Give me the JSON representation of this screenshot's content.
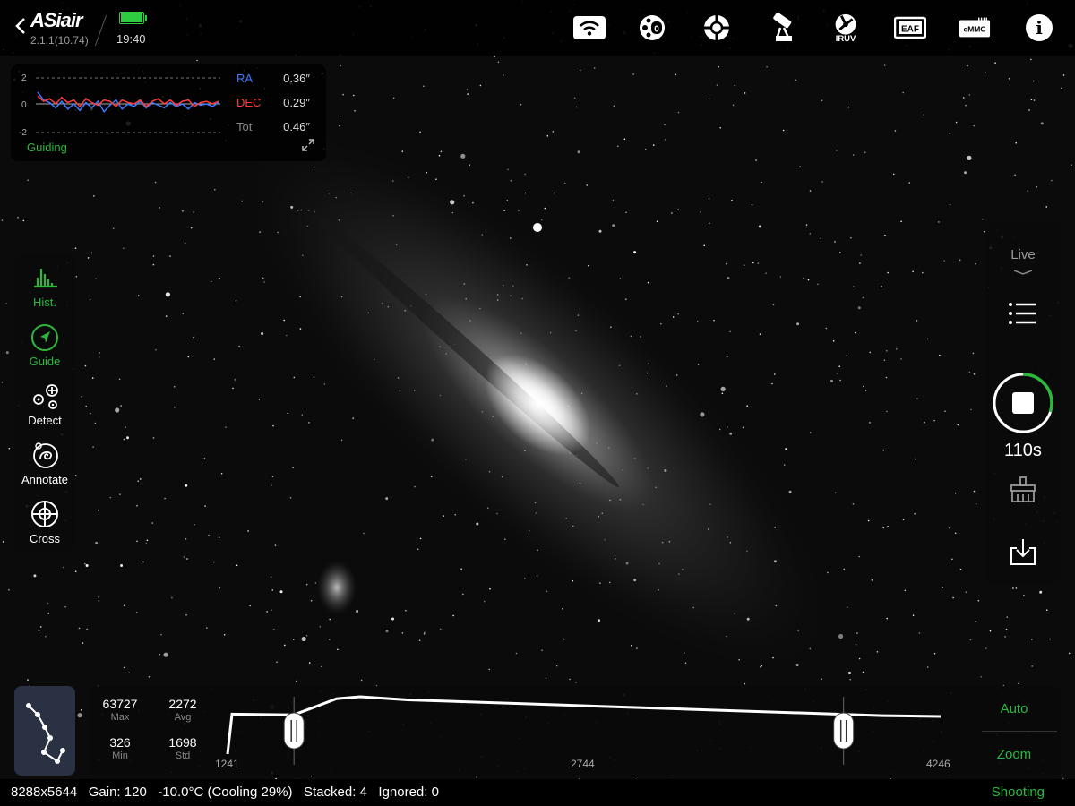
{
  "app": {
    "logo": "ASiair",
    "version": "2.1.1(10.74)",
    "time": "19:40"
  },
  "topbar_icons": [
    "wifi-icon",
    "filter-wheel-icon",
    "focus-target-icon",
    "telescope-mount-icon",
    "iruv-icon",
    "eaf-icon",
    "emmc-icon",
    "info-icon"
  ],
  "topbar_badges": {
    "iruv": "IRUV",
    "eaf": "EAF",
    "emmc": "eMMC",
    "filter": "0",
    "info": "i"
  },
  "guiding": {
    "title": "Guiding",
    "axis": {
      "top": "2",
      "mid": "0",
      "bottom": "-2"
    },
    "ra": {
      "label": "RA",
      "value": "0.36″",
      "color": "#3a7bff"
    },
    "dec": {
      "label": "DEC",
      "value": "0.29″",
      "color": "#ff3b3b"
    },
    "tot": {
      "label": "Tot",
      "value": "0.46″"
    },
    "chart_data": {
      "type": "line",
      "ylim": [
        -2,
        2
      ],
      "series": [
        {
          "name": "RA",
          "values": [
            0.9,
            0.3,
            0.1,
            -0.3,
            0.2,
            -0.4,
            0.0,
            -0.5,
            0.1,
            -0.3,
            0.2,
            -0.6,
            -0.1,
            0.3,
            -0.4,
            0.0,
            -0.2,
            0.2,
            -0.3,
            0.1,
            -0.1,
            -0.3,
            0.1,
            -0.2,
            0.0,
            -0.4,
            0.1,
            -0.1,
            0.0,
            -0.2,
            0.1
          ]
        },
        {
          "name": "DEC",
          "values": [
            0.6,
            0.2,
            0.4,
            0.0,
            0.5,
            0.1,
            0.3,
            -0.2,
            0.4,
            0.1,
            -0.1,
            0.3,
            0.2,
            -0.2,
            0.3,
            0.1,
            0.0,
            0.3,
            -0.2,
            0.2,
            0.4,
            0.0,
            0.3,
            -0.1,
            0.2,
            0.3,
            -0.2,
            0.1,
            0.2,
            0.0,
            0.2
          ]
        }
      ]
    }
  },
  "left_tools": [
    {
      "label": "Hist.",
      "active": true
    },
    {
      "label": "Guide",
      "active": true
    },
    {
      "label": "Detect",
      "active": false
    },
    {
      "label": "Annotate",
      "active": false
    },
    {
      "label": "Cross",
      "active": false
    }
  ],
  "right_panel": {
    "mode": "Live",
    "timer": "110s",
    "progress": 0.3
  },
  "histogram": {
    "max": {
      "label": "Max",
      "value": "63727"
    },
    "avg": {
      "label": "Avg",
      "value": "2272"
    },
    "min": {
      "label": "Min",
      "value": "326"
    },
    "std": {
      "label": "Std",
      "value": "1698"
    },
    "ticks": [
      "1241",
      "2744",
      "4246"
    ],
    "auto_label": "Auto",
    "zoom_label": "Zoom",
    "chart_data": {
      "type": "area",
      "x": [
        1241,
        1260,
        1520,
        1600,
        1700,
        1800,
        2000,
        2400,
        2800,
        3200,
        3600,
        4000,
        4246
      ],
      "values": [
        0.27,
        0.56,
        0.54,
        0.72,
        0.95,
        1.0,
        0.92,
        0.84,
        0.76,
        0.68,
        0.6,
        0.52,
        0.5
      ],
      "xlim": [
        1241,
        4246
      ],
      "black_point": 1521,
      "white_point": 3837
    }
  },
  "status": {
    "text": "8288x5644   Gain: 120   -10.0°C (Cooling 29%)   Stacked: 4   Ignored: 0",
    "state": "Shooting"
  }
}
